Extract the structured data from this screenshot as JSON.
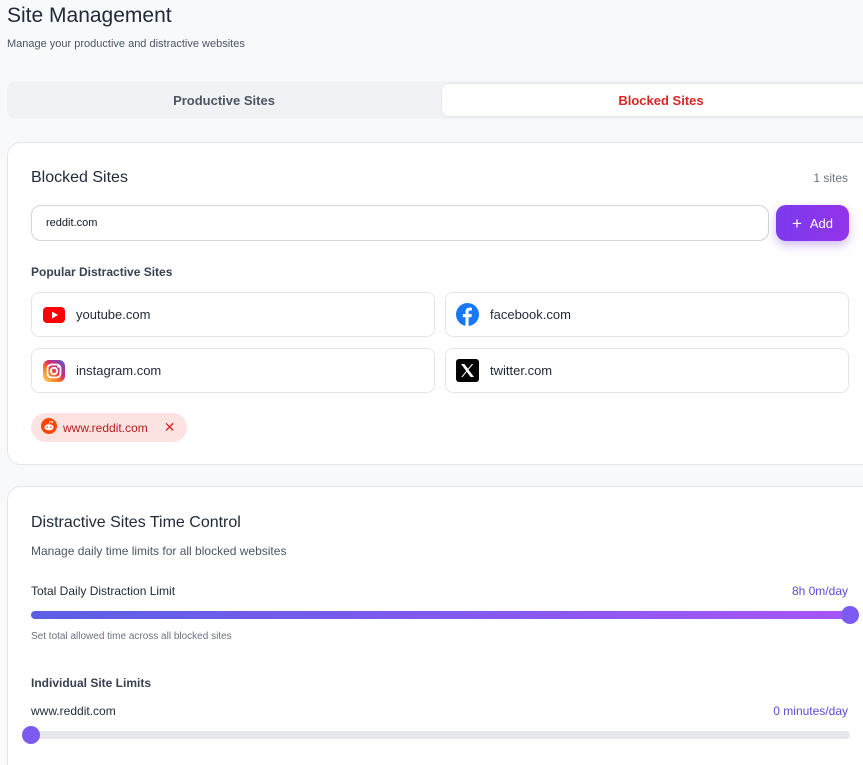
{
  "header": {
    "title": "Site Management",
    "subtitle": "Manage your productive and distractive websites"
  },
  "tabs": [
    {
      "label": "Productive Sites",
      "active": false
    },
    {
      "label": "Blocked Sites",
      "active": true
    }
  ],
  "blocked": {
    "title": "Blocked Sites",
    "count": "1 sites",
    "input_value": "reddit.com",
    "add_label": "Add",
    "popular_label": "Popular Distractive Sites",
    "popular": [
      {
        "name": "youtube.com",
        "icon": "youtube-icon"
      },
      {
        "name": "facebook.com",
        "icon": "facebook-icon"
      },
      {
        "name": "instagram.com",
        "icon": "instagram-icon"
      },
      {
        "name": "twitter.com",
        "icon": "x-twitter-icon"
      }
    ],
    "chips": [
      {
        "label": "www.reddit.com",
        "icon": "reddit-icon",
        "remove": "✕"
      }
    ]
  },
  "time_control": {
    "title": "Distractive Sites Time Control",
    "description": "Manage daily time limits for all blocked websites",
    "total_label": "Total Daily Distraction Limit",
    "total_value": "8h 0m/day",
    "total_fraction": 1.0,
    "total_hint": "Set total allowed time across all blocked sites",
    "individual_label": "Individual Site Limits",
    "sites": [
      {
        "name": "www.reddit.com",
        "value": "0 minutes/day",
        "fraction": 0.0
      }
    ]
  },
  "colors": {
    "accent": "#7c3aed",
    "danger": "#dc2626",
    "chip_bg": "#fde2e2",
    "value_text": "#5b4bd8"
  }
}
